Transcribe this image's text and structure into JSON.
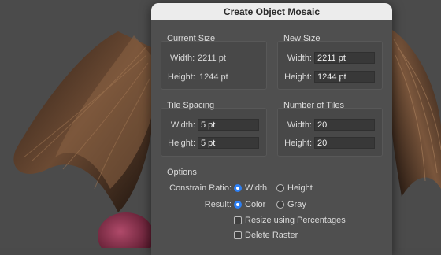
{
  "dialog": {
    "title": "Create Object Mosaic",
    "current_size": {
      "title": "Current Size",
      "width_label": "Width:",
      "width_value": "2211 pt",
      "height_label": "Height:",
      "height_value": "1244 pt"
    },
    "new_size": {
      "title": "New Size",
      "width_label": "Width:",
      "width_value": "2211 pt",
      "height_label": "Height:",
      "height_value": "1244 pt"
    },
    "tile_spacing": {
      "title": "Tile Spacing",
      "width_label": "Width:",
      "width_value": "5 pt",
      "height_label": "Height:",
      "height_value": "5 pt"
    },
    "number_of_tiles": {
      "title": "Number of Tiles",
      "width_label": "Width:",
      "width_value": "20",
      "height_label": "Height:",
      "height_value": "20"
    },
    "options": {
      "title": "Options",
      "constrain_label": "Constrain Ratio:",
      "constrain_width": "Width",
      "constrain_height": "Height",
      "constrain_selected": "Width",
      "result_label": "Result:",
      "result_color": "Color",
      "result_gray": "Gray",
      "result_selected": "Color",
      "resize_percentages": "Resize using Percentages",
      "resize_percentages_checked": false,
      "delete_raster": "Delete Raster",
      "delete_raster_checked": false
    }
  },
  "colors": {
    "accent": "#2d7ff3",
    "dialog_bg": "#4f4f4f",
    "titlebar_bg": "#ececec",
    "guide_line": "#5b6fd6"
  }
}
